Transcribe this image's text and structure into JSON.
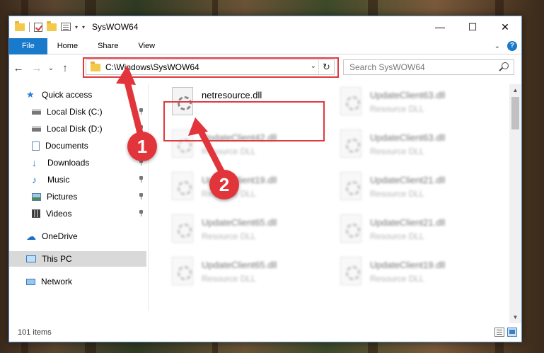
{
  "window": {
    "title": "SysWOW64",
    "minimize": "—",
    "maximize": "☐",
    "close": "✕"
  },
  "ribbon": {
    "tabs": [
      "File",
      "Home",
      "Share",
      "View"
    ],
    "expand_glyph": "⌄",
    "help_glyph": "?"
  },
  "nav": {
    "back": "←",
    "forward": "→",
    "recent": "⌄",
    "up": "↑",
    "address": "C:\\Windows\\SysWOW64",
    "refresh": "↻",
    "search_placeholder": "Search SysWOW64"
  },
  "sidebar": {
    "items": [
      {
        "label": "Quick access",
        "icon": "star-icon",
        "pinned": false
      },
      {
        "label": "Local Disk (C:)",
        "icon": "drive-icon",
        "pinned": true
      },
      {
        "label": "Local Disk (D:)",
        "icon": "drive-icon",
        "pinned": true
      },
      {
        "label": "Documents",
        "icon": "document-icon",
        "pinned": true
      },
      {
        "label": "Downloads",
        "icon": "download-icon",
        "pinned": true
      },
      {
        "label": "Music",
        "icon": "music-icon",
        "pinned": true
      },
      {
        "label": "Pictures",
        "icon": "picture-icon",
        "pinned": true
      },
      {
        "label": "Videos",
        "icon": "video-icon",
        "pinned": true
      },
      {
        "label": "OneDrive",
        "icon": "cloud-icon",
        "pinned": false
      },
      {
        "label": "This PC",
        "icon": "computer-icon",
        "pinned": false,
        "selected": true
      },
      {
        "label": "Network",
        "icon": "network-icon",
        "pinned": false
      }
    ]
  },
  "files": {
    "left": [
      {
        "name": "netresource.dll",
        "type": "",
        "highlighted": true
      },
      {
        "name": "UpdateClient42.dll",
        "type": "Resource DLL"
      },
      {
        "name": "UpdateClient19.dll",
        "type": "Resource DLL"
      },
      {
        "name": "UpdateClient65.dll",
        "type": "Resource DLL"
      },
      {
        "name": "UpdateClient65.dll",
        "type": "Resource DLL"
      }
    ],
    "right": [
      {
        "name": "UpdateClient63.dll",
        "type": "Resource DLL"
      },
      {
        "name": "UpdateClient63.dll",
        "type": "Resource DLL"
      },
      {
        "name": "UpdateClient21.dll",
        "type": "Resource DLL"
      },
      {
        "name": "UpdateClient21.dll",
        "type": "Resource DLL"
      },
      {
        "name": "UpdateClient19.dll",
        "type": "Resource DLL"
      }
    ]
  },
  "status": {
    "item_count": "101 items"
  },
  "annotations": {
    "badge_1": "1",
    "badge_2": "2",
    "color": "#e2353b"
  }
}
